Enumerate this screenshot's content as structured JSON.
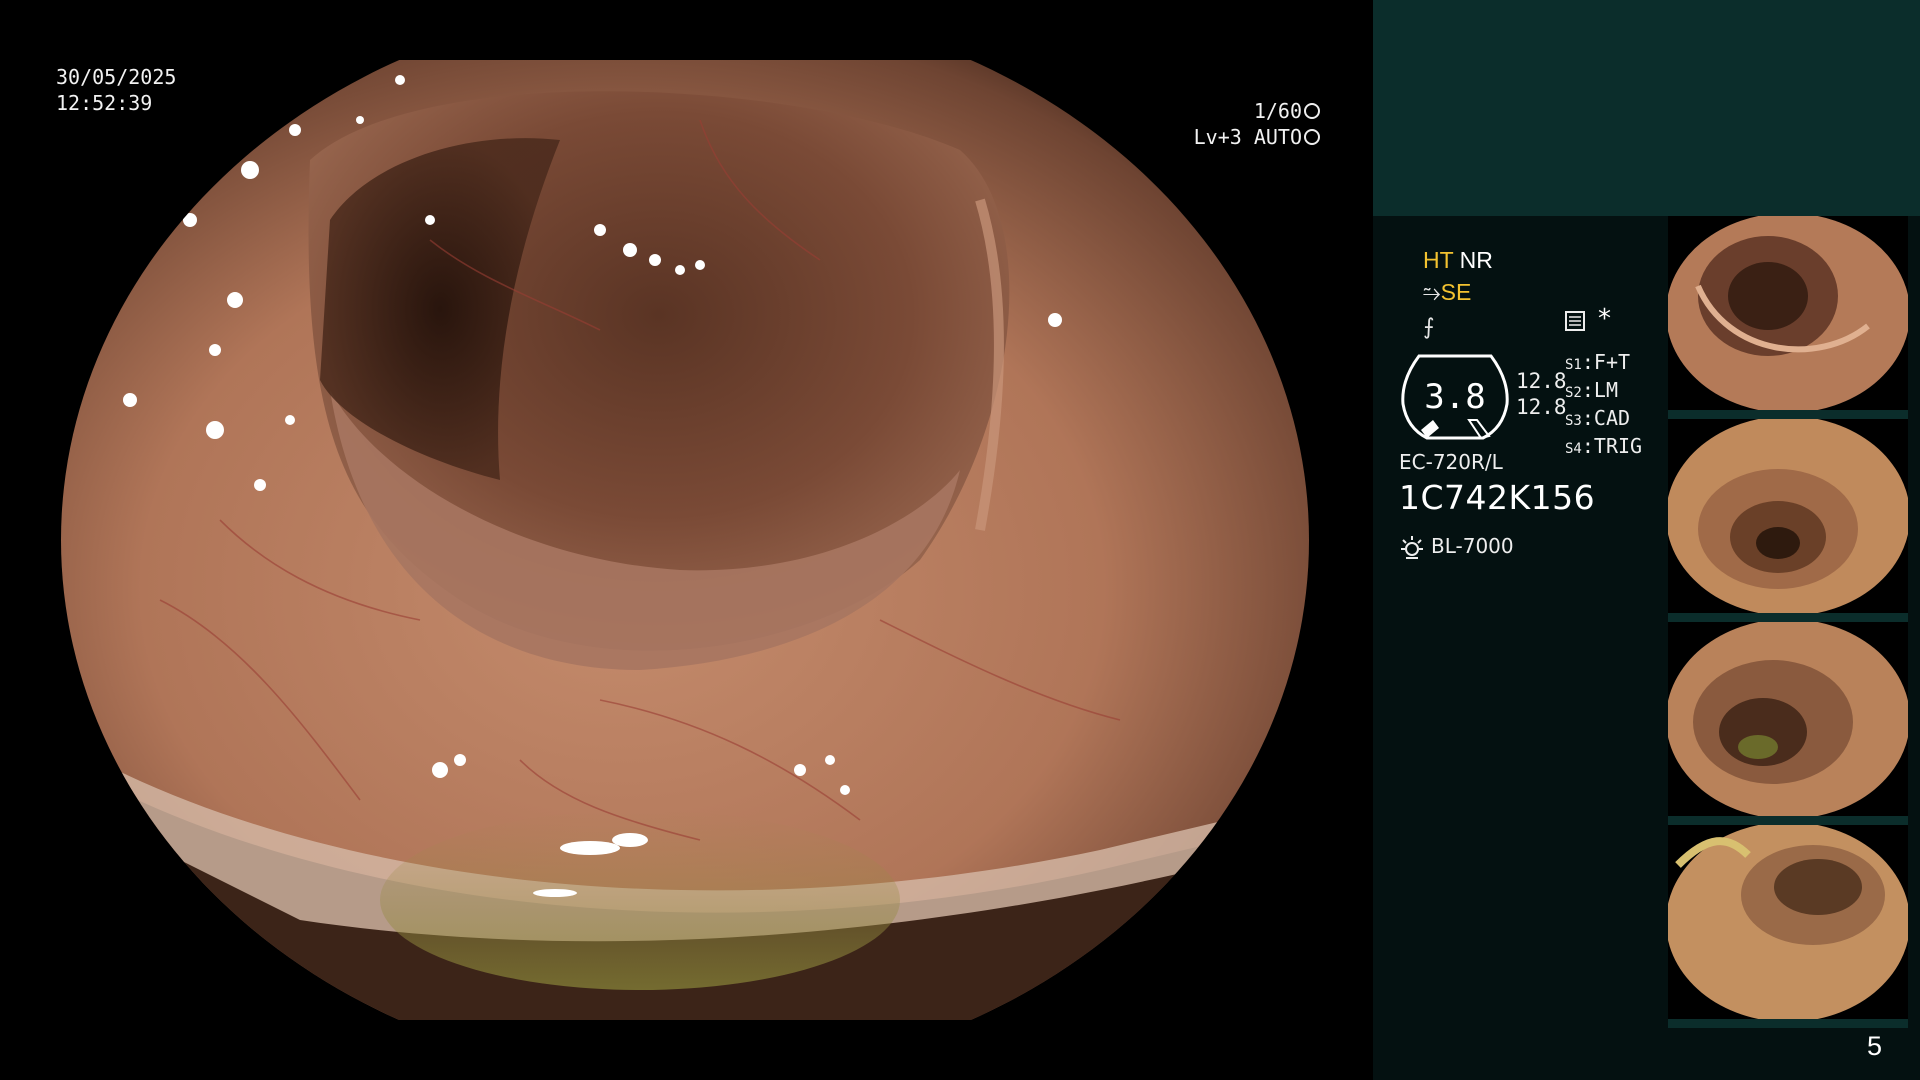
{
  "endoscopy": {
    "date": "30/05/2025",
    "time": "12:52:39",
    "shutter": "1/60",
    "exposure": "Lv+3 AUTO",
    "modes": {
      "ht": "HT",
      "nr": "NR",
      "se": "SE"
    },
    "zoom": "3.8",
    "zoom_sub_1": "12.8",
    "zoom_sub_2": "12.8",
    "switches": [
      {
        "key": "S1",
        "value": "F+T"
      },
      {
        "key": "S2",
        "value": "LM"
      },
      {
        "key": "S3",
        "value": "CAD"
      },
      {
        "key": "S4",
        "value": "TRIG"
      }
    ],
    "scope_model": "EC-720R/L",
    "scope_serial": "1C742K156",
    "light_source": "BL-7000",
    "page_number": "5",
    "star": "*"
  },
  "colors": {
    "accent_yellow": "#f3c230",
    "panel_bg": "#041111",
    "panel_top": "#0b2d2b",
    "mucosa": "#b37a5e"
  },
  "icons": [
    "shutter-icon",
    "auto-iris-icon",
    "structure-enhancement-icon",
    "color-mode-icon",
    "document-icon",
    "light-source-icon"
  ]
}
